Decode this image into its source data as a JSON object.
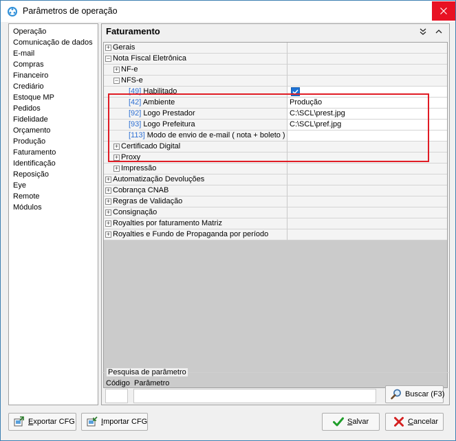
{
  "window": {
    "title": "Parâmetros de operação"
  },
  "nav": {
    "items": [
      "Operação",
      "Comunicação de dados",
      "E-mail",
      "Compras",
      "Financeiro",
      "Crediário",
      "Estoque MP",
      "Pedidos",
      "Fidelidade",
      "Orçamento",
      "Produção",
      "Faturamento",
      "Identificação",
      "Reposição",
      "Eye",
      "Remote",
      "Módulos"
    ]
  },
  "panel": {
    "title": "Faturamento"
  },
  "tree": {
    "gerais": "Gerais",
    "nfe_group": "Nota Fiscal Eletrônica",
    "nfe": "NF-e",
    "nfse": "NFS-e",
    "p49_code": "[49]",
    "p49_label": "Habilitado",
    "p42_code": "[42]",
    "p42_label": "Ambiente",
    "p42_value": "Produção",
    "p92_code": "[92]",
    "p92_label": "Logo Prestador",
    "p92_value": "C:\\SCL\\prest.jpg",
    "p93_code": "[93]",
    "p93_label": "Logo Prefeitura",
    "p93_value": "C:\\SCL\\pref.jpg",
    "p113_code": "[113]",
    "p113_label": "Modo de envio de e-mail ( nota + boleto )",
    "cert": "Certificado Digital",
    "proxy": "Proxy",
    "impressao": "Impressão",
    "auto_dev": "Automatização Devoluções",
    "cnab": "Cobrança CNAB",
    "regras": "Regras de Validação",
    "consig": "Consignação",
    "royal_mat": "Royalties por faturamento Matriz",
    "royal_fundo": "Royalties e Fundo de Propaganda por período"
  },
  "search": {
    "legend": "Pesquisa de parâmetro",
    "codigo_label": "Código",
    "param_label": "Parâmetro",
    "buscar_button": "Buscar (F3)"
  },
  "footer": {
    "export_pre": "",
    "export_ul": "E",
    "export_post": "xportar CFG",
    "import_pre": "",
    "import_ul": "I",
    "import_post": "mportar CFG",
    "salvar_ul": "S",
    "salvar_post": "alvar",
    "cancelar_ul": "C",
    "cancelar_post": "ancelar"
  },
  "colors": {
    "highlight": "#e01b24",
    "param_code": "#2d6fd3",
    "checkbox": "#1c72d6"
  }
}
